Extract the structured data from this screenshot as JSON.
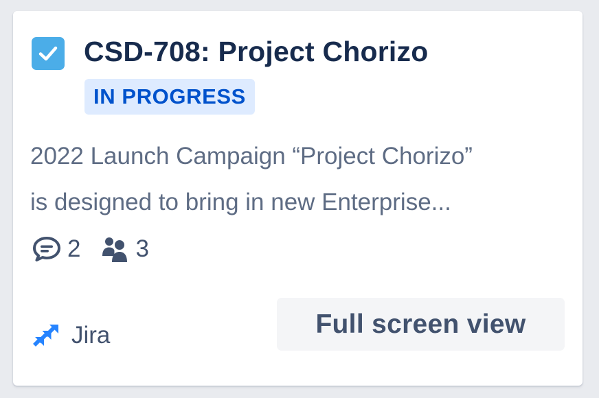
{
  "card": {
    "issue_key_title": "CSD-708: Project Chorizo",
    "status": "IN PROGRESS",
    "description_lines": [
      "2022 Launch Campaign “Project Chorizo”",
      "is designed to bring in new Enterprise..."
    ],
    "comments_count": "2",
    "watchers_count": "3",
    "source_name": "Jira",
    "fullscreen_label": "Full screen view",
    "icons": {
      "issue_type": "task-checkbox-icon",
      "comments": "comment-icon",
      "watchers": "people-icon",
      "source": "jira-logo-icon"
    },
    "colors": {
      "issue_icon": "#4bade8",
      "status_bg": "#deebff",
      "status_text": "#0052cc",
      "title": "#172b4d",
      "jira_brand": "#2684ff"
    }
  }
}
